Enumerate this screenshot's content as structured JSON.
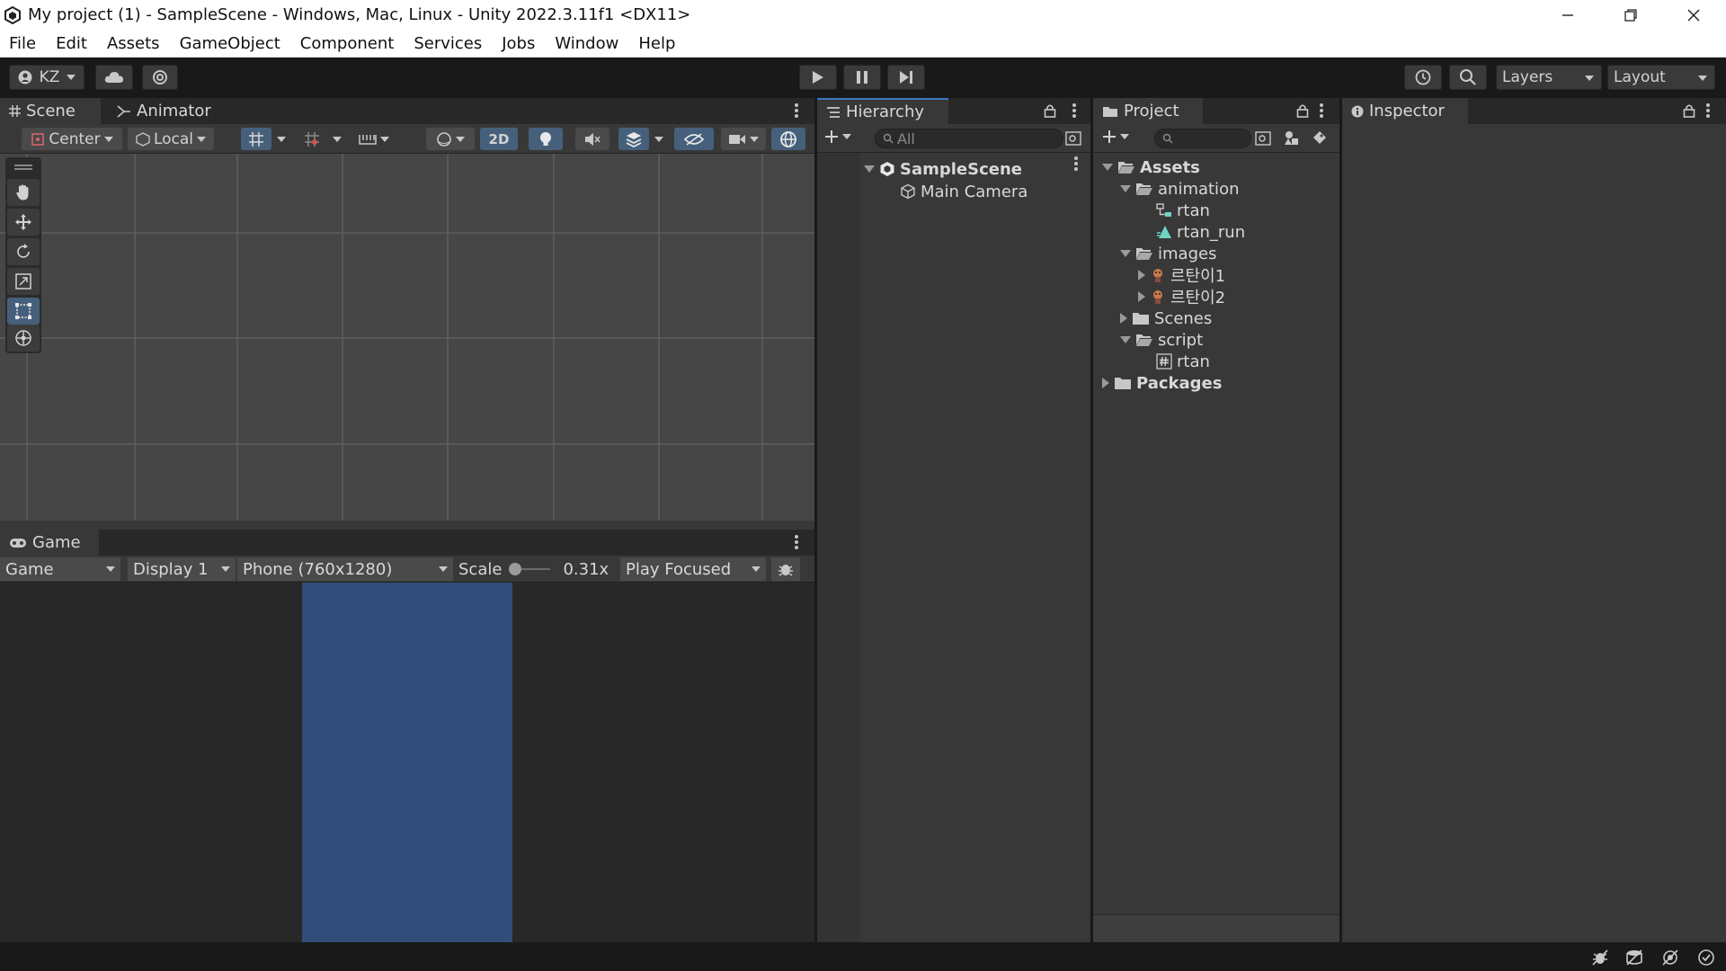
{
  "window": {
    "title": "My project (1) - SampleScene - Windows, Mac, Linux - Unity 2022.3.11f1 <DX11>"
  },
  "menu": [
    "File",
    "Edit",
    "Assets",
    "GameObject",
    "Component",
    "Services",
    "Jobs",
    "Window",
    "Help"
  ],
  "toolbar": {
    "account": "KZ",
    "layers": "Layers",
    "layout": "Layout"
  },
  "scene": {
    "tabs": {
      "scene": "Scene",
      "animator": "Animator"
    },
    "pivot": "Center",
    "space": "Local",
    "mode_2d": "2D"
  },
  "game": {
    "tab": "Game",
    "view": "Game",
    "display": "Display 1",
    "resolution": "Phone (760x1280)",
    "scale_label": "Scale",
    "scale_value": "0.31x",
    "play_mode": "Play Focused"
  },
  "hierarchy": {
    "tab": "Hierarchy",
    "search_placeholder": "All",
    "scene": "SampleScene",
    "items": [
      "Main Camera"
    ]
  },
  "project": {
    "tab": "Project",
    "tree": {
      "assets": "Assets",
      "animation": "animation",
      "rtan_controller": "rtan",
      "rtan_run": "rtan_run",
      "images": "images",
      "image1": "르탄이1",
      "image2": "르탄이2",
      "scenes": "Scenes",
      "script": "script",
      "rtan_script": "rtan",
      "packages": "Packages"
    }
  },
  "inspector": {
    "tab": "Inspector"
  },
  "colors": {
    "accent": "#3a79bb",
    "game_background": "#314d79",
    "panel": "#383838",
    "scene_bg": "#464646"
  }
}
